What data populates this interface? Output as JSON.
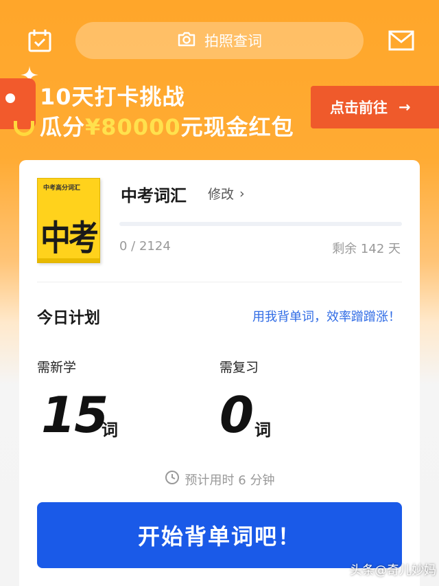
{
  "header": {
    "search_label": "拍照查词",
    "calendar_icon": "calendar-check-icon",
    "camera_icon": "camera-icon",
    "mail_icon": "mail-icon"
  },
  "banner": {
    "title": "10天打卡挑战",
    "sub_prefix": "瓜分",
    "sub_amount": "¥80000",
    "sub_suffix": "元现金红包",
    "cta_label": "点击前往",
    "cta_arrow": "→"
  },
  "book": {
    "cover_top": "中考高分词汇",
    "cover_big": "中考",
    "name": "中考词汇",
    "edit_label": "修改",
    "edit_chevron": "›",
    "progress_text": "0 / 2124",
    "progress_fraction": 0,
    "remaining_text": "剩余 142 天"
  },
  "plan": {
    "title": "今日计划",
    "slogan": "用我背单词，效率蹭蹭涨！",
    "new_label": "需新学",
    "new_count": "15",
    "review_label": "需复习",
    "review_count": "0",
    "unit": "词",
    "estimate": "预计用时 6 分钟"
  },
  "start_button": "开始背单词吧！",
  "watermark": "头条@奇儿妙妈",
  "colors": {
    "accent": "#1a5ae8",
    "banner_orange": "#ffa62a",
    "cta_red": "#ef5a2b",
    "amount_yellow": "#ffe14d"
  }
}
